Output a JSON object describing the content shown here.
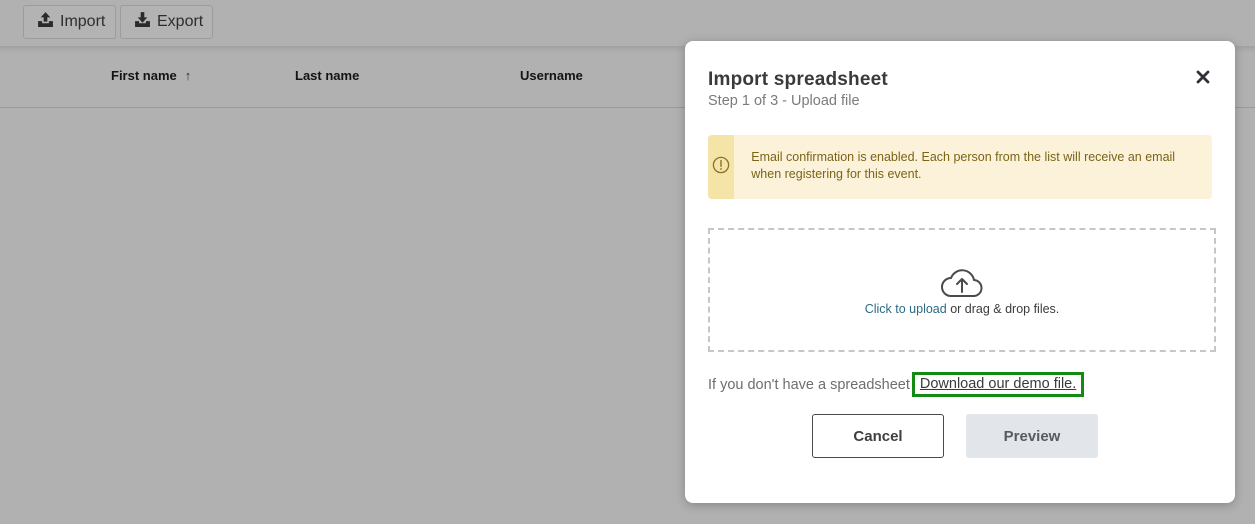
{
  "toolbar": {
    "import_label": "Import",
    "import_icon": "upload-icon",
    "export_label": "Export",
    "export_icon": "download-icon"
  },
  "table": {
    "columns": [
      {
        "label": "First name",
        "sort": "ascending",
        "sort_icon": "arrow-up-icon",
        "sort_glyph": "↑"
      },
      {
        "label": "Last name"
      },
      {
        "label": "Username"
      }
    ],
    "rows": []
  },
  "modal": {
    "title": "Import spreadsheet",
    "subtitle": "Step 1 of 3 - Upload file",
    "close_icon": "close-icon",
    "alert": {
      "icon": "exclamation-circle-icon",
      "text": "Email confirmation is enabled. Each person from the list will receive an email when registering for this event."
    },
    "dropzone": {
      "icon": "cloud-upload-icon",
      "link_text": "Click to upload",
      "text": " or drag & drop files."
    },
    "demo": {
      "prefix": "If you don't have a spreadsheet",
      "link": "Download our demo file."
    },
    "buttons": {
      "cancel": "Cancel",
      "preview": "Preview"
    }
  },
  "colors": {
    "overlay_bg": "#b1b1b1",
    "alert_bg": "#fcf2d9",
    "alert_icon_bg": "#f5e4a8",
    "alert_text": "#7a6418",
    "link": "#2d6a86",
    "highlight_border": "#138a13",
    "preview_bg": "#e2e5e9"
  }
}
